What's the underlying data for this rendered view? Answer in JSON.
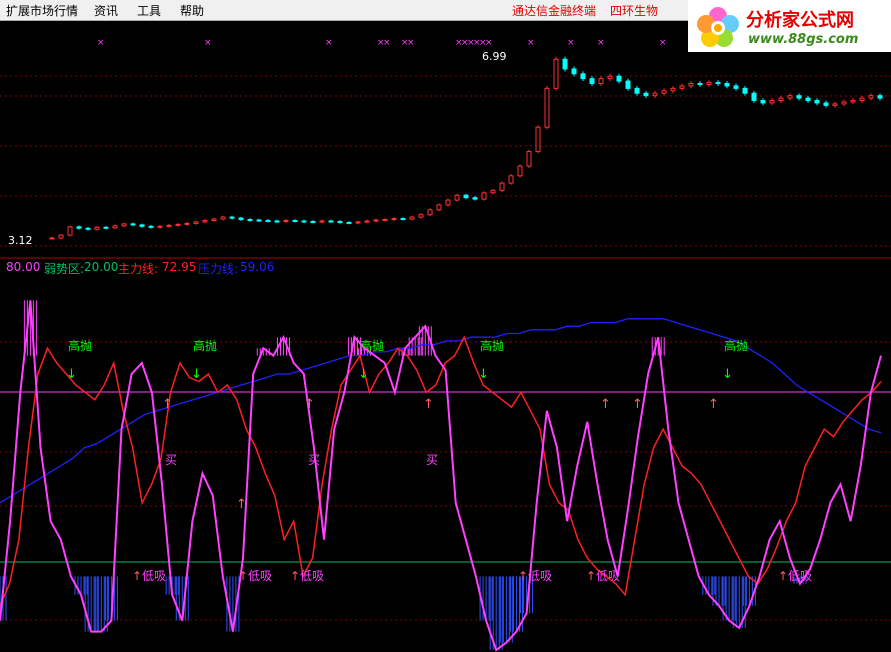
{
  "menu": {
    "items": [
      "扩展市场行情",
      "资讯",
      "工具",
      "帮助"
    ],
    "links": [
      "通达信金融终端",
      "四环生物"
    ]
  },
  "logo": {
    "title": "分析家公式网",
    "url": "www.88gs.com"
  },
  "price_panel": {
    "high_label": "6.99",
    "low_label": "3.12"
  },
  "indicator_header": {
    "strong_value": "80.00",
    "weak_label": "弱势区:",
    "weak_value": "20.00",
    "main_label": "主力线:",
    "main_value": "72.95",
    "pressure_label": "压力线:",
    "pressure_value": "59.06"
  },
  "signal_text": {
    "sell": "高抛",
    "buy": "买",
    "low_buy": "低吸"
  },
  "colors": {
    "up": "#ff3030",
    "down": "#00ffff",
    "main_line": "#ff2020",
    "pressure_line": "#2020ff",
    "magenta": "#ff40ff",
    "strong_line": "#ff40ff",
    "weak_line": "#00c060",
    "sell_arrow": "#00ff00",
    "buy_arrow": "#ff6060",
    "label_green": "#00ff00"
  },
  "chart_data": {
    "type": "line",
    "candles_close": [
      3.12,
      3.18,
      3.35,
      3.32,
      3.3,
      3.34,
      3.33,
      3.37,
      3.41,
      3.39,
      3.36,
      3.34,
      3.36,
      3.38,
      3.4,
      3.42,
      3.45,
      3.48,
      3.51,
      3.55,
      3.53,
      3.5,
      3.49,
      3.48,
      3.47,
      3.46,
      3.48,
      3.47,
      3.46,
      3.45,
      3.47,
      3.46,
      3.44,
      3.43,
      3.45,
      3.47,
      3.49,
      3.5,
      3.52,
      3.51,
      3.55,
      3.6,
      3.7,
      3.8,
      3.9,
      4.0,
      3.95,
      3.92,
      4.05,
      4.1,
      4.25,
      4.4,
      4.6,
      4.9,
      5.4,
      6.2,
      6.8,
      6.6,
      6.5,
      6.4,
      6.3,
      6.4,
      6.45,
      6.35,
      6.2,
      6.1,
      6.05,
      6.1,
      6.15,
      6.2,
      6.25,
      6.3,
      6.28,
      6.32,
      6.3,
      6.25,
      6.2,
      6.1,
      5.95,
      5.9,
      5.95,
      6.0,
      6.05,
      6.0,
      5.95,
      5.9,
      5.85,
      5.88,
      5.92,
      5.95,
      6.0,
      6.05,
      6.0
    ],
    "main_line": [
      12,
      18,
      30,
      55,
      75,
      82,
      78,
      75,
      72,
      70,
      68,
      72,
      78,
      65,
      55,
      40,
      45,
      52,
      70,
      78,
      74,
      73,
      75,
      70,
      72,
      68,
      60,
      55,
      48,
      42,
      30,
      35,
      20,
      25,
      45,
      60,
      72,
      76,
      80,
      70,
      75,
      78,
      82,
      80,
      76,
      70,
      72,
      78,
      80,
      85,
      78,
      72,
      70,
      68,
      66,
      70,
      65,
      60,
      45,
      40,
      38,
      30,
      25,
      22,
      20,
      18,
      15,
      30,
      45,
      55,
      60,
      55,
      50,
      48,
      45,
      40,
      35,
      30,
      25,
      20,
      18,
      22,
      28,
      35,
      40,
      50,
      55,
      60,
      58,
      62,
      65,
      68,
      70,
      72.95
    ],
    "pressure_line": [
      40,
      42,
      44,
      46,
      48,
      50,
      52,
      55,
      56,
      58,
      60,
      62,
      64,
      65,
      66,
      67,
      68,
      69,
      70,
      71,
      72,
      73,
      74,
      75,
      75,
      76,
      77,
      78,
      79,
      80,
      80,
      81,
      81,
      82,
      82,
      83,
      83,
      84,
      84,
      85,
      85,
      85,
      86,
      86,
      87,
      87,
      87,
      88,
      88,
      89,
      89,
      89,
      90,
      90,
      90,
      90,
      89,
      88,
      87,
      86,
      85,
      84,
      82,
      80,
      78,
      75,
      72,
      70,
      68,
      66,
      64,
      62,
      60,
      59.06
    ],
    "ylim_price": [
      3.12,
      6.99
    ],
    "ylim_indicator": [
      0,
      100
    ]
  }
}
